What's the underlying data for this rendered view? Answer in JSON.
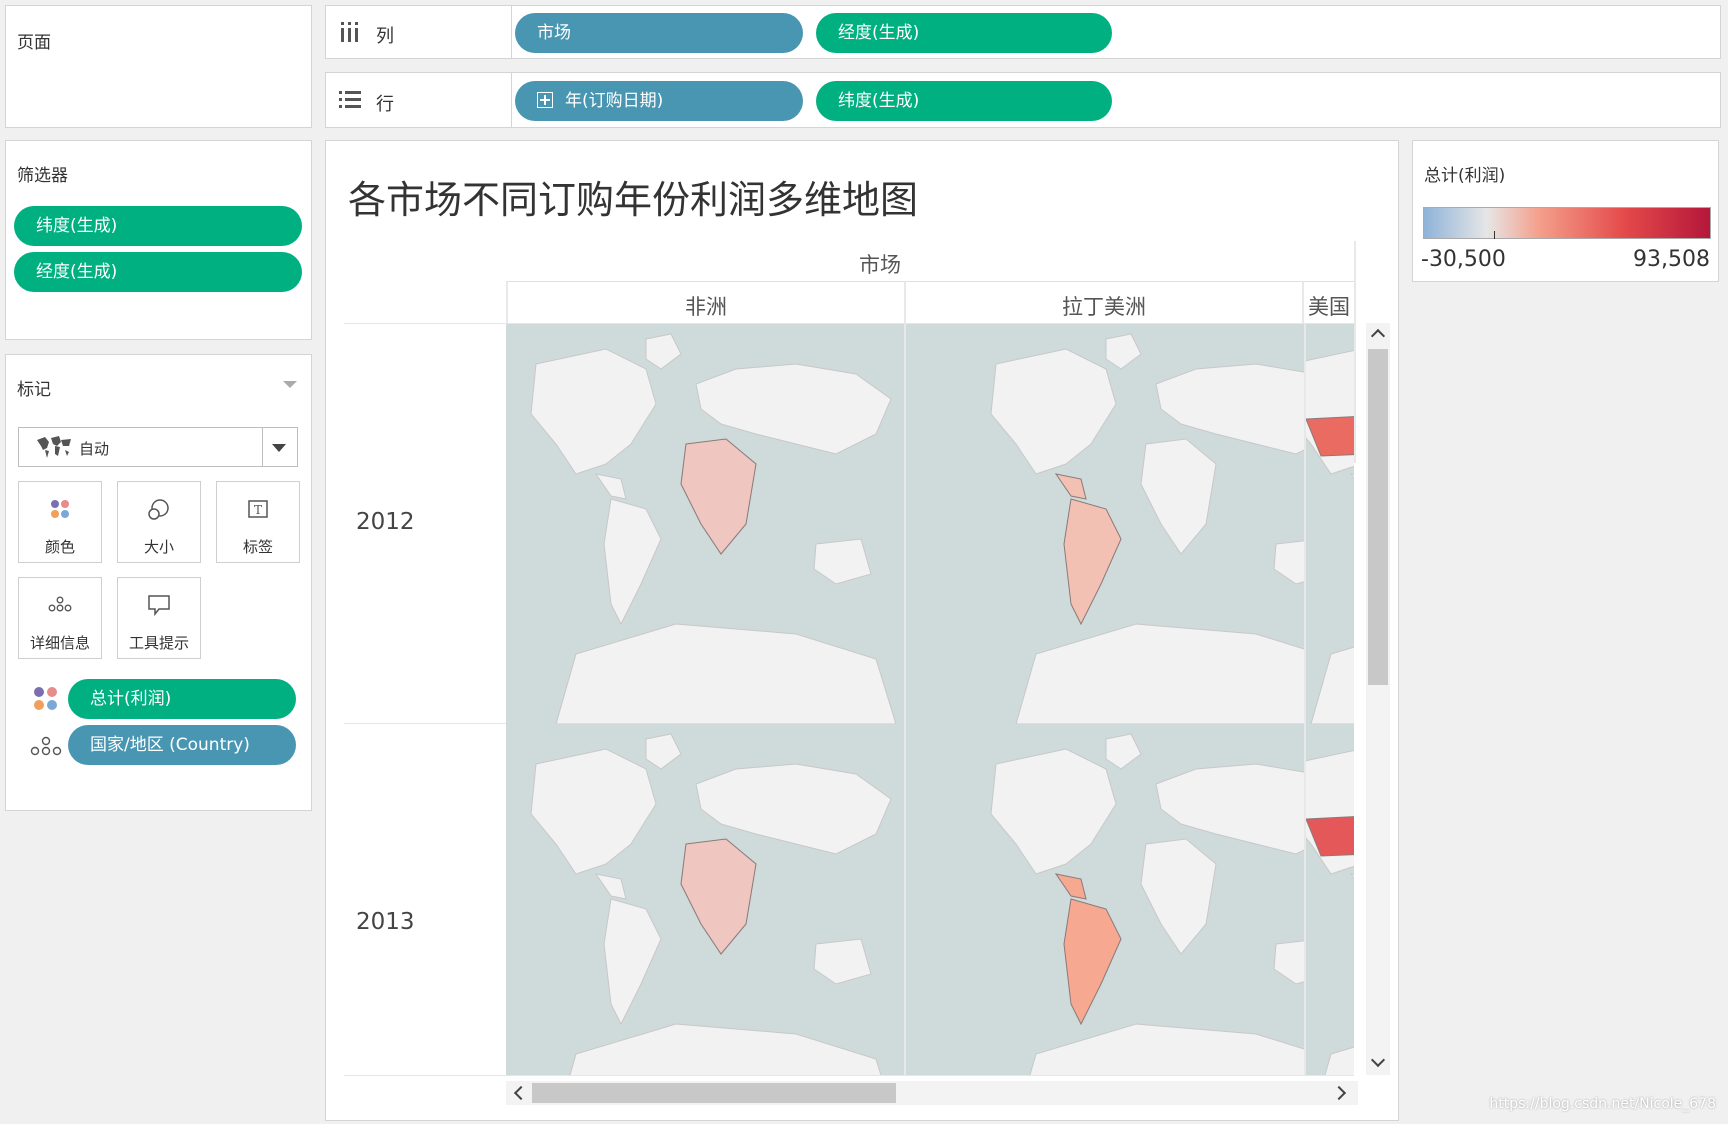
{
  "pages_panel": {
    "title": "页面"
  },
  "columns_shelf": {
    "label": "列",
    "pills": [
      "市场",
      "经度(生成)"
    ]
  },
  "rows_shelf": {
    "label": "行",
    "pills": [
      "年(订购日期)",
      "纬度(生成)"
    ]
  },
  "filters_panel": {
    "title": "筛选器",
    "pills": [
      "纬度(生成)",
      "经度(生成)"
    ]
  },
  "marks_panel": {
    "title": "标记",
    "mark_type": "自动",
    "cards": [
      "颜色",
      "大小",
      "标签",
      "详细信息",
      "工具提示"
    ],
    "fields": [
      "总计(利润)",
      "国家/地区 (Country)"
    ]
  },
  "legend": {
    "title": "总计(利润)",
    "min": "-30,500",
    "max": "93,508",
    "colors": [
      "#8fb3d9",
      "#e6e6e6",
      "#f4a08c",
      "#e44a4a",
      "#b4173a"
    ]
  },
  "view": {
    "title": "各市场不同订购年份利润多维地图",
    "col_header": "市场",
    "markets": [
      "非洲",
      "拉丁美洲",
      "美国"
    ],
    "years": [
      "2012",
      "2013"
    ]
  },
  "watermark": "https://blog.csdn.net/Nicole_678"
}
